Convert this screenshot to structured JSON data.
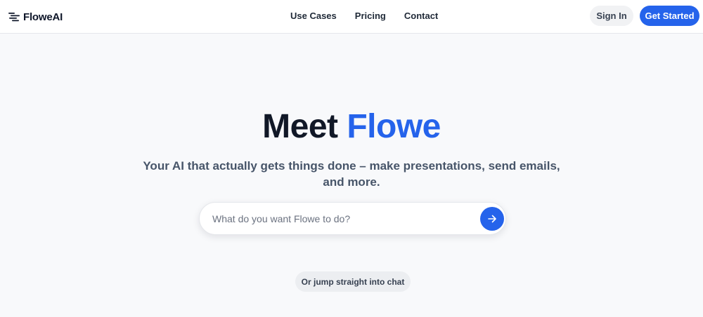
{
  "header": {
    "brand_name": "FloweAI",
    "nav": [
      {
        "label": "Use Cases"
      },
      {
        "label": "Pricing"
      },
      {
        "label": "Contact"
      }
    ],
    "sign_in_label": "Sign In",
    "get_started_label": "Get Started"
  },
  "hero": {
    "title_prefix": "Meet",
    "title_accent": "Flowe",
    "subtitle": "Your AI that actually gets things done – make presentations, send emails, and more.",
    "search": {
      "value": "",
      "placeholder": "What do you want Flowe to do?"
    },
    "chat_link_label": "Or jump straight into chat"
  },
  "colors": {
    "accent": "#2563eb",
    "page_background": "#f8f9fb",
    "heading": "#111827",
    "subtitle": "#475569"
  },
  "icons": {
    "logo": "flowing-lines-logo-icon",
    "submit": "arrow-right-icon"
  }
}
